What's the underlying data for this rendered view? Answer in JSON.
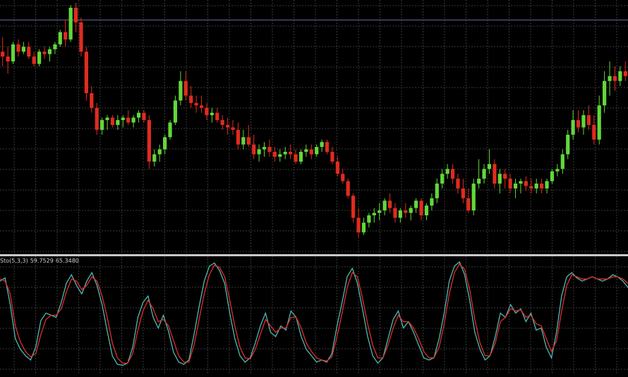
{
  "colors": {
    "background": "#000000",
    "grid": "#3a3a3a",
    "bull": "#62d83a",
    "bear": "#e02b20",
    "wick_bull": "#62d83a",
    "wick_bear": "#e02b20",
    "h_line": "#6a6aa8",
    "separator": "#c8c8c8",
    "stoch_main": "#4fb8b8",
    "stoch_signal": "#e0302a"
  },
  "indicator_label": {
    "name": "Sto(5,3,3)",
    "main_value": "59.7529",
    "signal_value": "65.3480"
  },
  "chart_data": [
    {
      "type": "candlestick",
      "title": "",
      "grid": true,
      "ylim": [
        0,
        100
      ],
      "horizontal_line": 93,
      "candles": [
        [
          80,
          86,
          74,
          78
        ],
        [
          78,
          82,
          71,
          76
        ],
        [
          76,
          84,
          75,
          83
        ],
        [
          83,
          85,
          78,
          80
        ],
        [
          80,
          84,
          79,
          82
        ],
        [
          82,
          84,
          77,
          78
        ],
        [
          78,
          80,
          74,
          75
        ],
        [
          75,
          81,
          74,
          80
        ],
        [
          80,
          82,
          77,
          79
        ],
        [
          79,
          82,
          76,
          81
        ],
        [
          81,
          84,
          79,
          83
        ],
        [
          83,
          89,
          82,
          88
        ],
        [
          88,
          93,
          82,
          85
        ],
        [
          85,
          99,
          84,
          98
        ],
        [
          98,
          100,
          88,
          92
        ],
        [
          92,
          94,
          78,
          80
        ],
        [
          80,
          82,
          60,
          63
        ],
        [
          63,
          66,
          55,
          57
        ],
        [
          57,
          59,
          46,
          48
        ],
        [
          48,
          53,
          46,
          52
        ],
        [
          52,
          54,
          48,
          53
        ],
        [
          53,
          54,
          49,
          50
        ],
        [
          50,
          54,
          48,
          52
        ],
        [
          52,
          54,
          49,
          53
        ],
        [
          53,
          56,
          50,
          51
        ],
        [
          51,
          54,
          49,
          53
        ],
        [
          53,
          56,
          51,
          55
        ],
        [
          55,
          56,
          51,
          52
        ],
        [
          52,
          54,
          32,
          35
        ],
        [
          35,
          40,
          33,
          38
        ],
        [
          38,
          42,
          35,
          40
        ],
        [
          40,
          46,
          38,
          45
        ],
        [
          45,
          52,
          44,
          51
        ],
        [
          51,
          62,
          50,
          60
        ],
        [
          60,
          72,
          58,
          68
        ],
        [
          68,
          72,
          60,
          62
        ],
        [
          62,
          66,
          57,
          59
        ],
        [
          59,
          62,
          55,
          58
        ],
        [
          58,
          62,
          55,
          57
        ],
        [
          57,
          59,
          52,
          54
        ],
        [
          54,
          57,
          51,
          55
        ],
        [
          55,
          57,
          51,
          52
        ],
        [
          52,
          54,
          48,
          50
        ],
        [
          50,
          53,
          46,
          49
        ],
        [
          49,
          52,
          46,
          48
        ],
        [
          48,
          51,
          40,
          42
        ],
        [
          42,
          48,
          40,
          45
        ],
        [
          45,
          50,
          41,
          42
        ],
        [
          42,
          46,
          36,
          38
        ],
        [
          38,
          42,
          35,
          40
        ],
        [
          40,
          43,
          37,
          41
        ],
        [
          41,
          44,
          37,
          39
        ],
        [
          39,
          41,
          35,
          37
        ],
        [
          37,
          40,
          35,
          38
        ],
        [
          38,
          41,
          36,
          39
        ],
        [
          39,
          42,
          36,
          38
        ],
        [
          38,
          40,
          34,
          35
        ],
        [
          35,
          40,
          34,
          39
        ],
        [
          39,
          42,
          37,
          40
        ],
        [
          40,
          42,
          36,
          38
        ],
        [
          38,
          42,
          37,
          41
        ],
        [
          41,
          44,
          39,
          43
        ],
        [
          43,
          44,
          38,
          39
        ],
        [
          39,
          41,
          34,
          35
        ],
        [
          35,
          37,
          29,
          30
        ],
        [
          30,
          32,
          26,
          27
        ],
        [
          27,
          28,
          20,
          21
        ],
        [
          21,
          22,
          10,
          12
        ],
        [
          12,
          16,
          4,
          6
        ],
        [
          6,
          12,
          5,
          10
        ],
        [
          10,
          14,
          8,
          13
        ],
        [
          13,
          16,
          10,
          14
        ],
        [
          14,
          18,
          11,
          15
        ],
        [
          15,
          20,
          13,
          19
        ],
        [
          19,
          22,
          14,
          16
        ],
        [
          16,
          18,
          10,
          12
        ],
        [
          12,
          16,
          10,
          15
        ],
        [
          15,
          18,
          12,
          14
        ],
        [
          14,
          17,
          11,
          16
        ],
        [
          16,
          20,
          14,
          19
        ],
        [
          19,
          20,
          11,
          13
        ],
        [
          13,
          18,
          11,
          17
        ],
        [
          17,
          22,
          15,
          20
        ],
        [
          20,
          28,
          18,
          26
        ],
        [
          26,
          32,
          24,
          30
        ],
        [
          30,
          34,
          28,
          32
        ],
        [
          32,
          34,
          26,
          28
        ],
        [
          28,
          30,
          22,
          24
        ],
        [
          24,
          28,
          18,
          20
        ],
        [
          20,
          24,
          14,
          15
        ],
        [
          15,
          28,
          13,
          26
        ],
        [
          26,
          36,
          24,
          28
        ],
        [
          28,
          34,
          26,
          32
        ],
        [
          32,
          40,
          30,
          34
        ],
        [
          34,
          36,
          24,
          26
        ],
        [
          26,
          32,
          22,
          30
        ],
        [
          30,
          32,
          24,
          28
        ],
        [
          28,
          30,
          22,
          24
        ],
        [
          24,
          28,
          20,
          26
        ],
        [
          26,
          28,
          22,
          27
        ],
        [
          27,
          29,
          23,
          25
        ],
        [
          25,
          28,
          22,
          24
        ],
        [
          24,
          28,
          22,
          26
        ],
        [
          26,
          28,
          22,
          24
        ],
        [
          24,
          28,
          22,
          27
        ],
        [
          27,
          32,
          26,
          31
        ],
        [
          31,
          34,
          29,
          32
        ],
        [
          32,
          40,
          30,
          38
        ],
        [
          38,
          48,
          36,
          46
        ],
        [
          46,
          56,
          44,
          52
        ],
        [
          52,
          56,
          47,
          49
        ],
        [
          49,
          56,
          46,
          54
        ],
        [
          54,
          58,
          48,
          50
        ],
        [
          50,
          54,
          42,
          44
        ],
        [
          44,
          62,
          42,
          58
        ],
        [
          58,
          72,
          55,
          68
        ],
        [
          68,
          76,
          62,
          70
        ],
        [
          70,
          74,
          64,
          68
        ],
        [
          68,
          74,
          66,
          72
        ],
        [
          72,
          76,
          68,
          70
        ]
      ]
    },
    {
      "type": "line",
      "title": "Sto(5,3,3)",
      "grid": true,
      "ylim": [
        0,
        100
      ],
      "series": [
        {
          "name": "Sto(5,3,3)",
          "values": [
            82,
            85,
            60,
            28,
            18,
            12,
            8,
            20,
            45,
            52,
            50,
            48,
            62,
            80,
            88,
            78,
            70,
            82,
            90,
            78,
            60,
            35,
            12,
            4,
            3,
            5,
            20,
            48,
            62,
            68,
            48,
            38,
            50,
            35,
            15,
            6,
            4,
            8,
            32,
            58,
            82,
            96,
            99,
            92,
            80,
            52,
            28,
            12,
            6,
            10,
            24,
            40,
            52,
            34,
            30,
            40,
            36,
            54,
            48,
            30,
            18,
            12,
            6,
            8,
            6,
            14,
            40,
            62,
            86,
            94,
            80,
            56,
            30,
            12,
            5,
            10,
            28,
            46,
            54,
            38,
            44,
            34,
            22,
            10,
            8,
            10,
            28,
            52,
            82,
            96,
            100,
            88,
            64,
            34,
            18,
            8,
            12,
            30,
            52,
            48,
            60,
            52,
            56,
            44,
            52,
            36,
            38,
            20,
            10,
            34,
            68,
            86,
            90,
            85,
            82,
            84,
            86,
            84,
            82,
            84,
            88,
            86,
            82,
            76
          ]
        },
        {
          "name": "Sto(5,3,3)",
          "values": [
            84,
            82,
            70,
            40,
            25,
            16,
            11,
            14,
            32,
            46,
            50,
            50,
            56,
            72,
            84,
            82,
            74,
            78,
            86,
            82,
            68,
            48,
            24,
            10,
            5,
            5,
            14,
            36,
            54,
            64,
            56,
            44,
            46,
            40,
            26,
            12,
            6,
            6,
            22,
            46,
            70,
            88,
            97,
            95,
            86,
            64,
            40,
            20,
            10,
            9,
            18,
            32,
            46,
            40,
            34,
            38,
            38,
            48,
            48,
            38,
            24,
            16,
            10,
            8,
            7,
            11,
            30,
            52,
            76,
            90,
            86,
            66,
            42,
            22,
            10,
            10,
            22,
            38,
            50,
            44,
            44,
            38,
            28,
            16,
            10,
            10,
            20,
            42,
            70,
            90,
            98,
            93,
            74,
            46,
            24,
            12,
            12,
            24,
            44,
            48,
            56,
            54,
            55,
            48,
            50,
            42,
            40,
            28,
            16,
            26,
            54,
            78,
            88,
            86,
            84,
            84,
            86,
            84,
            84,
            84,
            86,
            86,
            84,
            80
          ]
        }
      ]
    }
  ]
}
